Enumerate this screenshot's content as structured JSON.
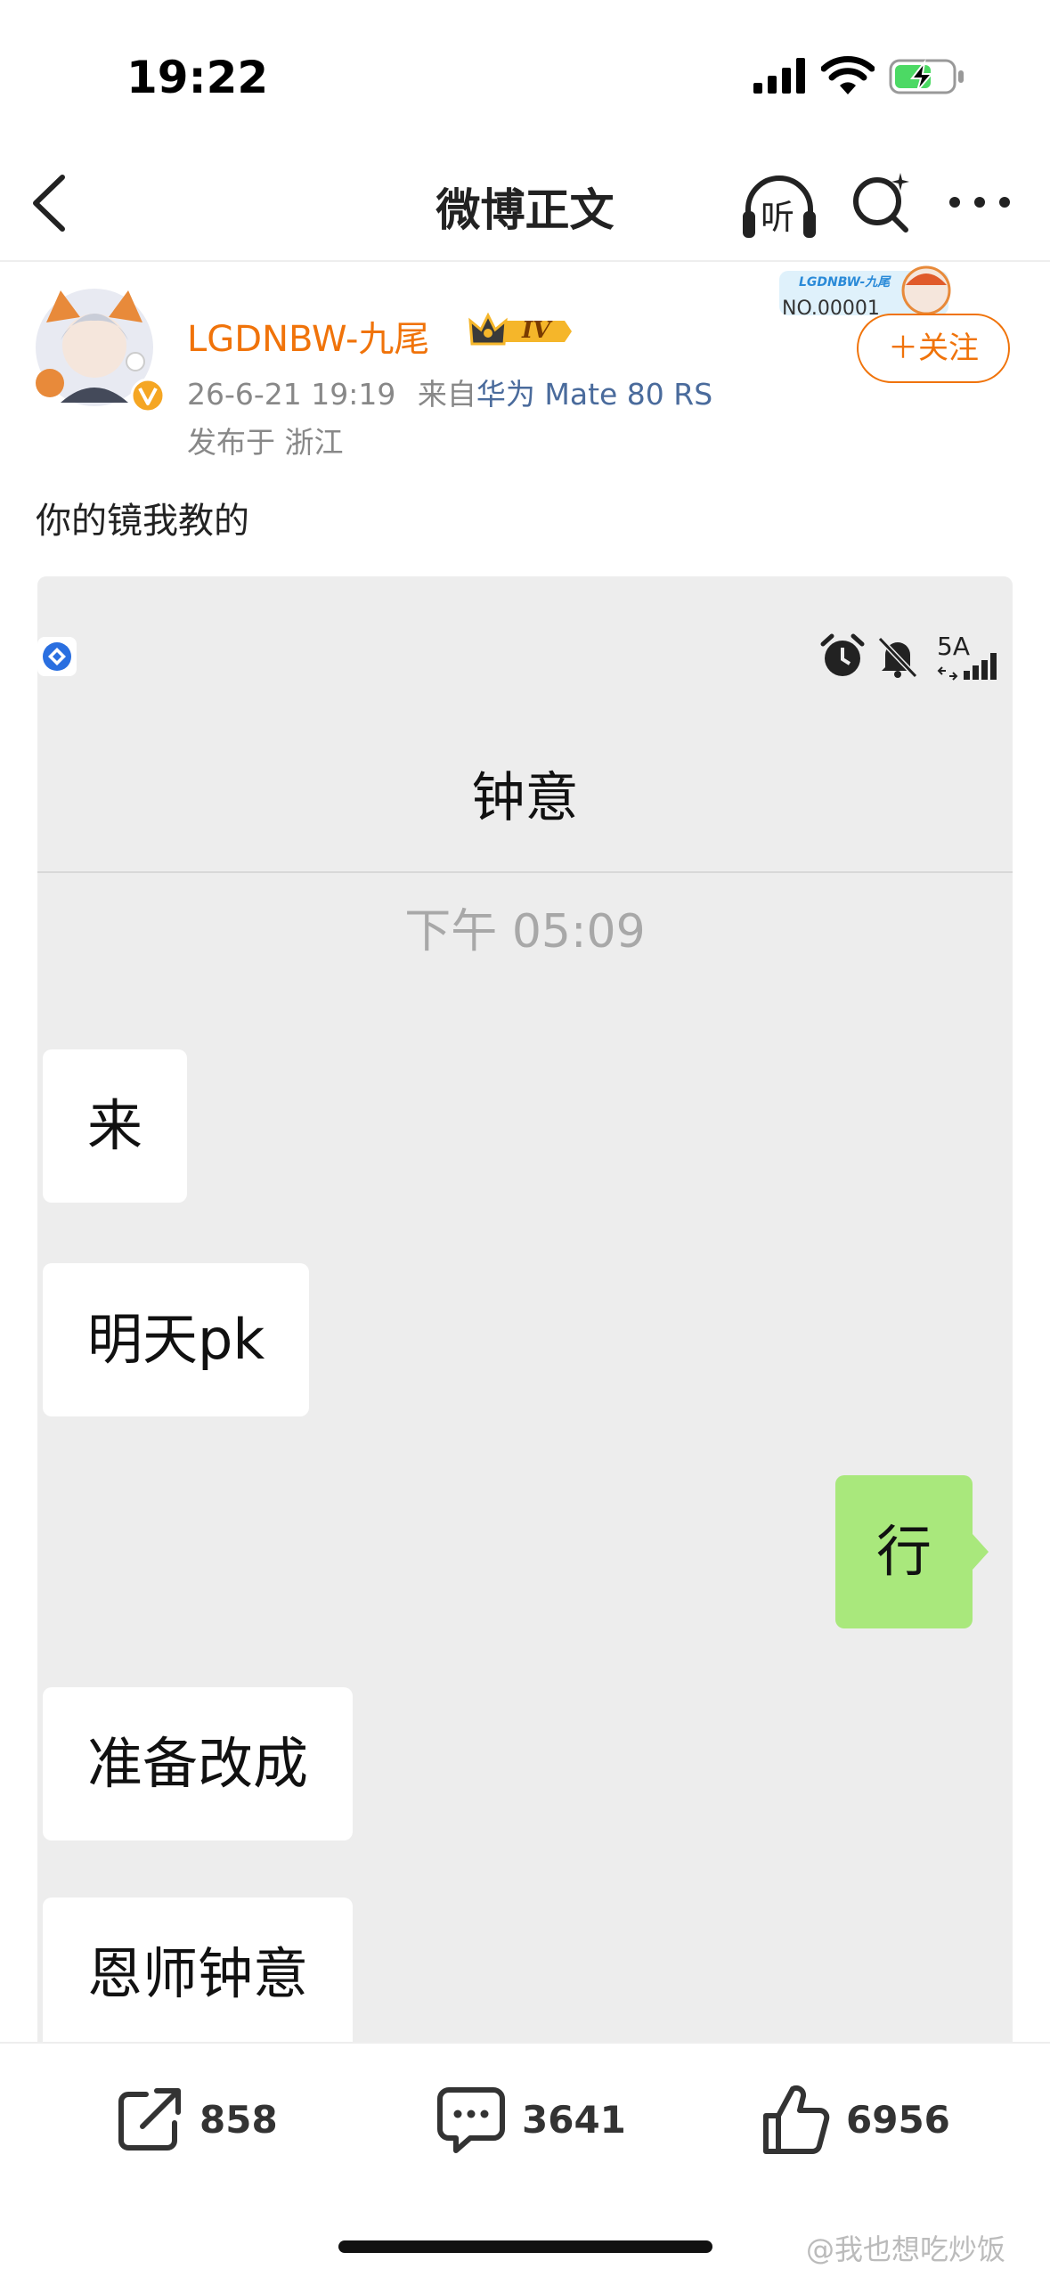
{
  "status_bar": {
    "time": "19:22"
  },
  "nav": {
    "title": "微博正文",
    "listen_label": "听"
  },
  "post": {
    "user_name": "LGDNBW-九尾",
    "vip_level": "IV",
    "date": "26-6-21 19:19",
    "source_prefix": "来自",
    "source_device": "华为 Mate 80 RS",
    "location": "发布于 浙江",
    "fan_badge_name": "LGDNBW-九尾",
    "fan_badge_no": "NO.00001",
    "follow_label": "＋关注",
    "text": "你的镜我教的"
  },
  "screenshot": {
    "signal_text": "5A",
    "title": "钟意",
    "time": "下午 05:09",
    "messages": [
      {
        "side": "in",
        "text": "来"
      },
      {
        "side": "in",
        "text": "明天pk"
      },
      {
        "side": "out",
        "text": "行"
      },
      {
        "side": "in",
        "text": "准备改成"
      },
      {
        "side": "in",
        "text": "恩师钟意"
      }
    ]
  },
  "toolbar": {
    "reposts": "858",
    "comments": "3641",
    "likes": "6956"
  },
  "watermark": "@我也想吃炒饭",
  "colors": {
    "accent": "#f0730a",
    "outgoing_bubble": "#a9e87c",
    "chat_bg": "#ededed",
    "source_link": "#4a6b9c"
  }
}
